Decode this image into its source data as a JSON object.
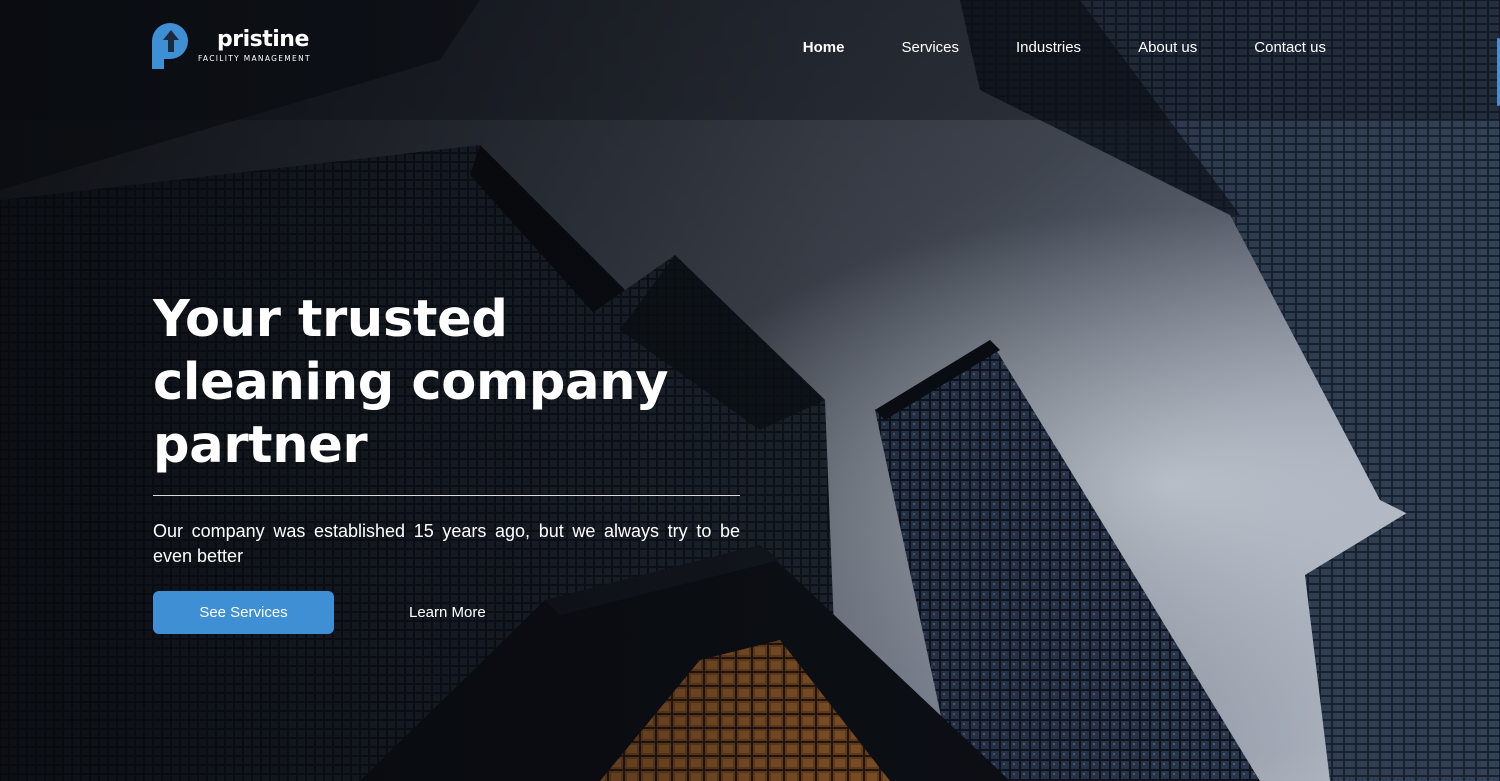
{
  "brand": {
    "name": "pristine",
    "tagline": "FACILITY MANAGEMENT",
    "accent_color": "#3f8fd4"
  },
  "nav": {
    "items": [
      {
        "label": "Home",
        "active": true
      },
      {
        "label": "Services",
        "active": false
      },
      {
        "label": "Industries",
        "active": false
      },
      {
        "label": "About us",
        "active": false
      },
      {
        "label": "Contact us",
        "active": false
      }
    ]
  },
  "hero": {
    "title_lines": [
      "Your trusted",
      "cleaning company",
      "partner"
    ],
    "description": "Our company was established 15 years ago, but we always try to be even better",
    "primary_button": "See Services",
    "secondary_link": "Learn More"
  },
  "icons": {
    "logo": "pristine-logo-icon"
  }
}
